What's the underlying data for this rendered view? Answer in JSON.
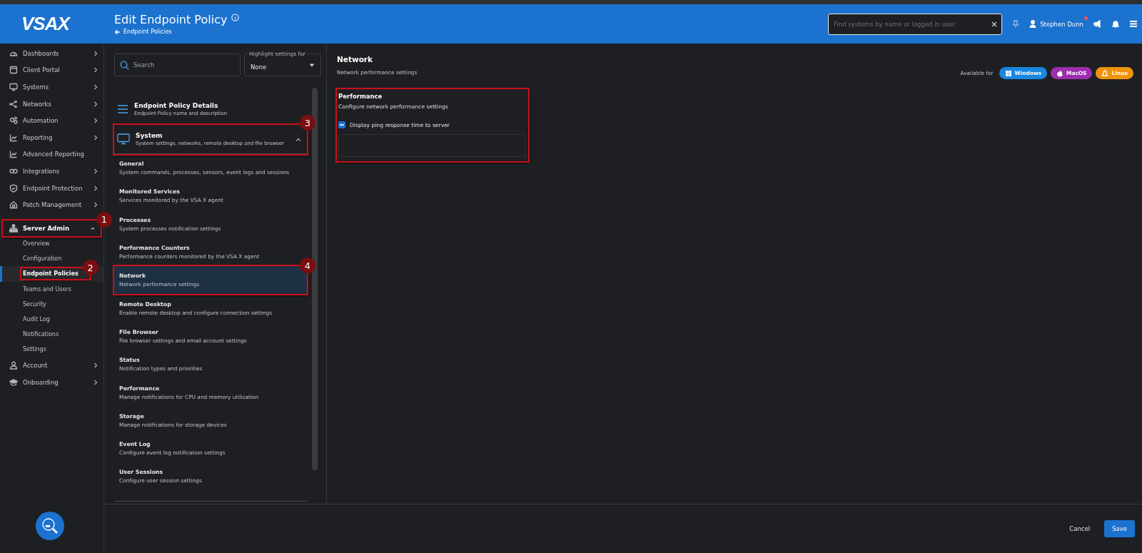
{
  "header": {
    "logo": "VSAX",
    "title": "Edit Endpoint Policy",
    "back_link": "Endpoint Policies",
    "search": {
      "placeholder": "Find systems by name or logged in user"
    },
    "user": "Stephen Dunn",
    "user_alert": true
  },
  "sidebar": {
    "items": [
      {
        "label": "Dashboards",
        "expandable": true
      },
      {
        "label": "Client Portal",
        "expandable": true
      },
      {
        "label": "Systems",
        "expandable": true
      },
      {
        "label": "Networks",
        "expandable": true
      },
      {
        "label": "Automation",
        "expandable": true
      },
      {
        "label": "Reporting",
        "expandable": true
      },
      {
        "label": "Advanced Reporting",
        "expandable": false
      },
      {
        "label": "Integrations",
        "expandable": true
      },
      {
        "label": "Endpoint Protection",
        "expandable": true
      },
      {
        "label": "Patch Management",
        "expandable": true
      },
      {
        "label": "Server Admin",
        "expandable": true,
        "expanded": true,
        "callout": "1",
        "children": [
          {
            "label": "Overview",
            "selected": false
          },
          {
            "label": "Configuration",
            "selected": false
          },
          {
            "label": "Endpoint Policies",
            "selected": true,
            "callout": "2"
          },
          {
            "label": "Teams and Users",
            "selected": false
          },
          {
            "label": "Security",
            "selected": false
          },
          {
            "label": "Audit Log",
            "selected": false
          },
          {
            "label": "Notifications",
            "selected": false
          },
          {
            "label": "Settings",
            "selected": false
          }
        ]
      },
      {
        "label": "Account",
        "expandable": true
      },
      {
        "label": "Onboarding",
        "expandable": true
      }
    ]
  },
  "settings_panel": {
    "search": {
      "placeholder": "Search"
    },
    "highlight": {
      "label": "Highlight settings for",
      "value": "None"
    },
    "sections": [
      {
        "kind": "details",
        "title": "Endpoint Policy Details",
        "subtitle": "Endpoint Policy name and description"
      },
      {
        "kind": "group",
        "title": "System",
        "subtitle": "System settings, networks, remote desktop and file browser",
        "expanded": true,
        "callout": "3",
        "children": [
          {
            "title": "General",
            "subtitle": "System commands, processes, sensors, event logs and sessions",
            "selected": false
          },
          {
            "title": "Monitored Services",
            "subtitle": "Services monitored by the VSA X agent",
            "selected": false
          },
          {
            "title": "Processes",
            "subtitle": "System processes notification settings",
            "selected": false
          },
          {
            "title": "Performance Counters",
            "subtitle": "Performance counters monitored by the VSA X agent",
            "selected": false
          },
          {
            "title": "Network",
            "subtitle": "Network performance settings",
            "selected": true,
            "callout": "4"
          },
          {
            "title": "Remote Desktop",
            "subtitle": "Enable remote desktop and configure connection settings",
            "selected": false
          },
          {
            "title": "File Browser",
            "subtitle": "File browser settings and email account settings",
            "selected": false
          },
          {
            "title": "Status",
            "subtitle": "Notification types and priorities",
            "selected": false
          },
          {
            "title": "Performance",
            "subtitle": "Manage notifications for CPU and memory utilization",
            "selected": false
          },
          {
            "title": "Storage",
            "subtitle": "Manage notifications for storage devices",
            "selected": false
          },
          {
            "title": "Event Log",
            "subtitle": "Configure event log notification settings",
            "selected": false
          },
          {
            "title": "User Sessions",
            "subtitle": "Configure user session settings",
            "selected": false
          }
        ]
      }
    ]
  },
  "content": {
    "title": "Network",
    "subtitle": "Network performance settings",
    "available_label": "Available for",
    "platforms": [
      {
        "label": "Windows",
        "color": "#1a86e0"
      },
      {
        "label": "MacOS",
        "color": "#9b2fae"
      },
      {
        "label": "Linux",
        "color": "#f0930a"
      }
    ],
    "section": {
      "title": "Performance",
      "subtitle": "Configure network performance settings",
      "outlined": true,
      "options": [
        {
          "label": "Display ping response time to server",
          "checked": true,
          "indeterminate": true
        }
      ]
    }
  },
  "footer": {
    "buttons": [
      {
        "label": "Cancel",
        "kind": "text"
      },
      {
        "label": "Save",
        "kind": "primary"
      }
    ]
  }
}
